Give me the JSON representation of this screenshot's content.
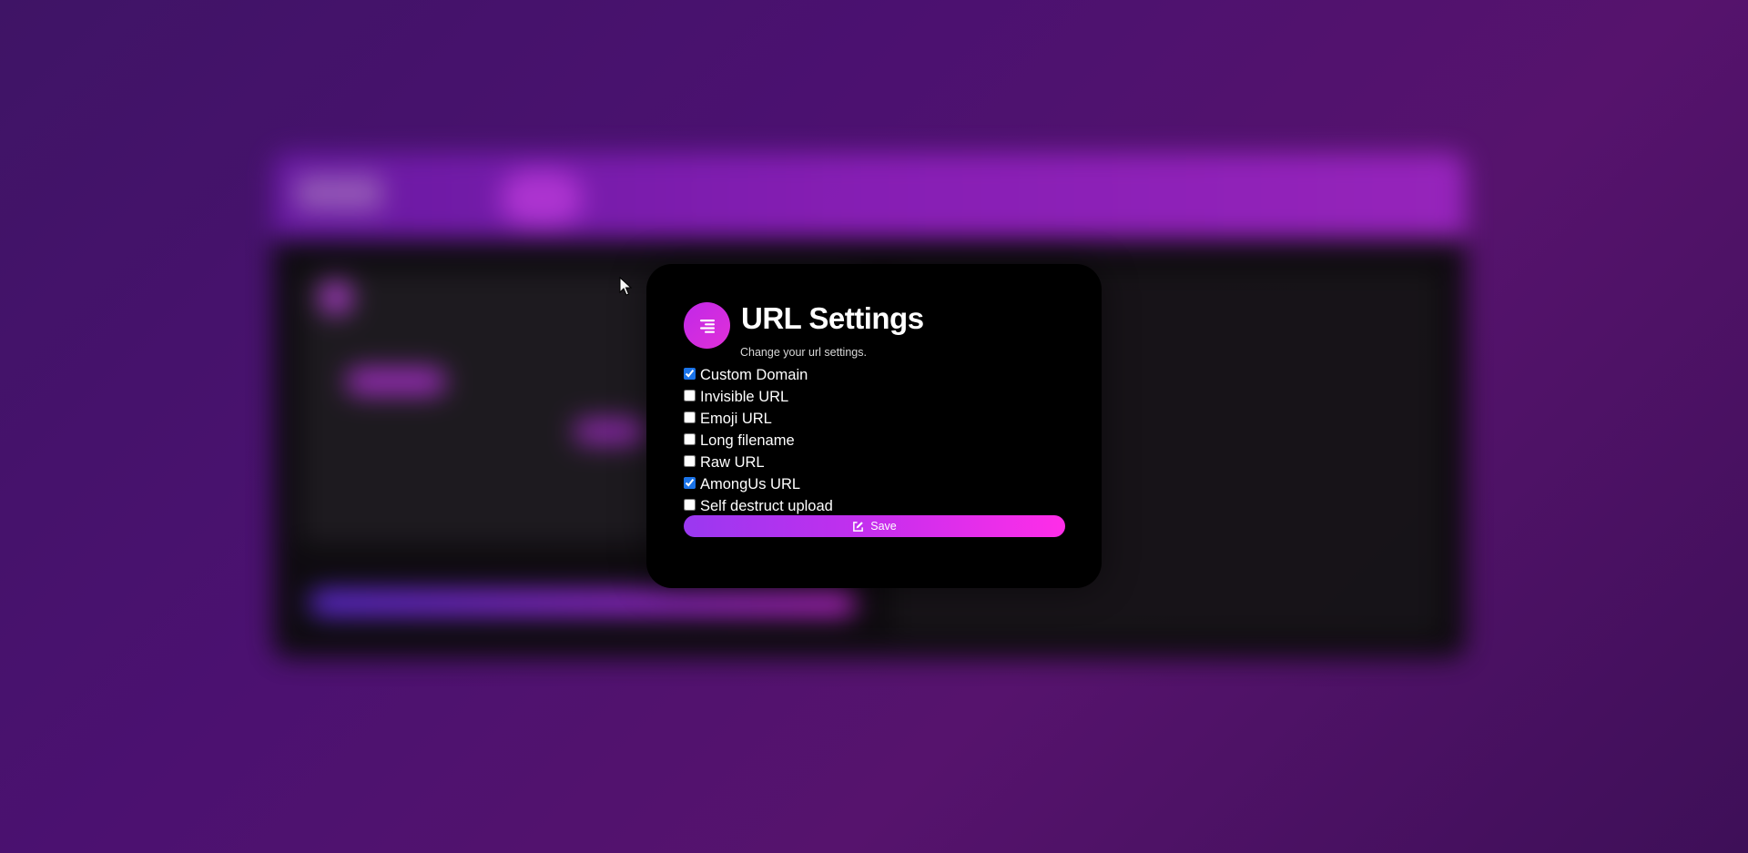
{
  "modal": {
    "title": "URL Settings",
    "subtitle": "Change your url settings.",
    "icon": "align-right-icon",
    "accent_color": "#d22ee6",
    "options": [
      {
        "label": "Custom Domain",
        "checked": true
      },
      {
        "label": "Invisible URL",
        "checked": false
      },
      {
        "label": "Emoji URL",
        "checked": false
      },
      {
        "label": "Long filename",
        "checked": false
      },
      {
        "label": "Raw URL",
        "checked": false
      },
      {
        "label": "AmongUs URL",
        "checked": true
      },
      {
        "label": "Self destruct upload",
        "checked": false
      }
    ],
    "save_label": "Save",
    "save_icon": "edit-icon"
  }
}
